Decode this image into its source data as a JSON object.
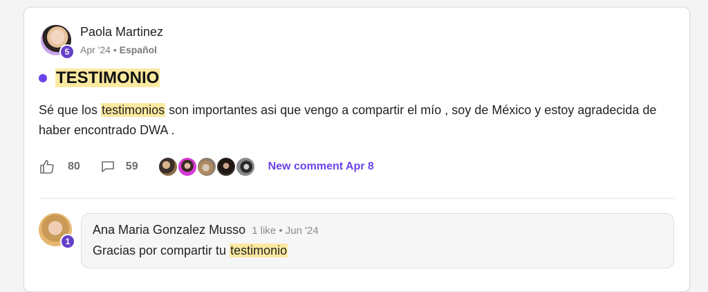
{
  "post": {
    "author": {
      "name": "Paola Martinez",
      "level": "5",
      "date": "Apr '24",
      "separator": "•",
      "language": "Español"
    },
    "title": "TESTIMONIO",
    "body": {
      "before": "Sé que los ",
      "highlight": "testimonios",
      "after": " son importantes asi que vengo a compartir el mío , soy de México y estoy agradecida de haber encontrado DWA ."
    },
    "likes": "80",
    "comments": "59",
    "new_comment": "New comment Apr 8",
    "icons": {
      "like": "thumbs-up-icon",
      "comment": "comment-bubble-icon"
    },
    "accent_color": "#6a44e8",
    "highlight_color": "#fbe9a0"
  },
  "reply": {
    "author": "Ana Maria Gonzalez Musso",
    "level": "1",
    "likes_text": "1 like",
    "separator": "•",
    "date": "Jun '24",
    "text_before": "Gracias por compartir tu ",
    "text_highlight": "testimonio"
  }
}
